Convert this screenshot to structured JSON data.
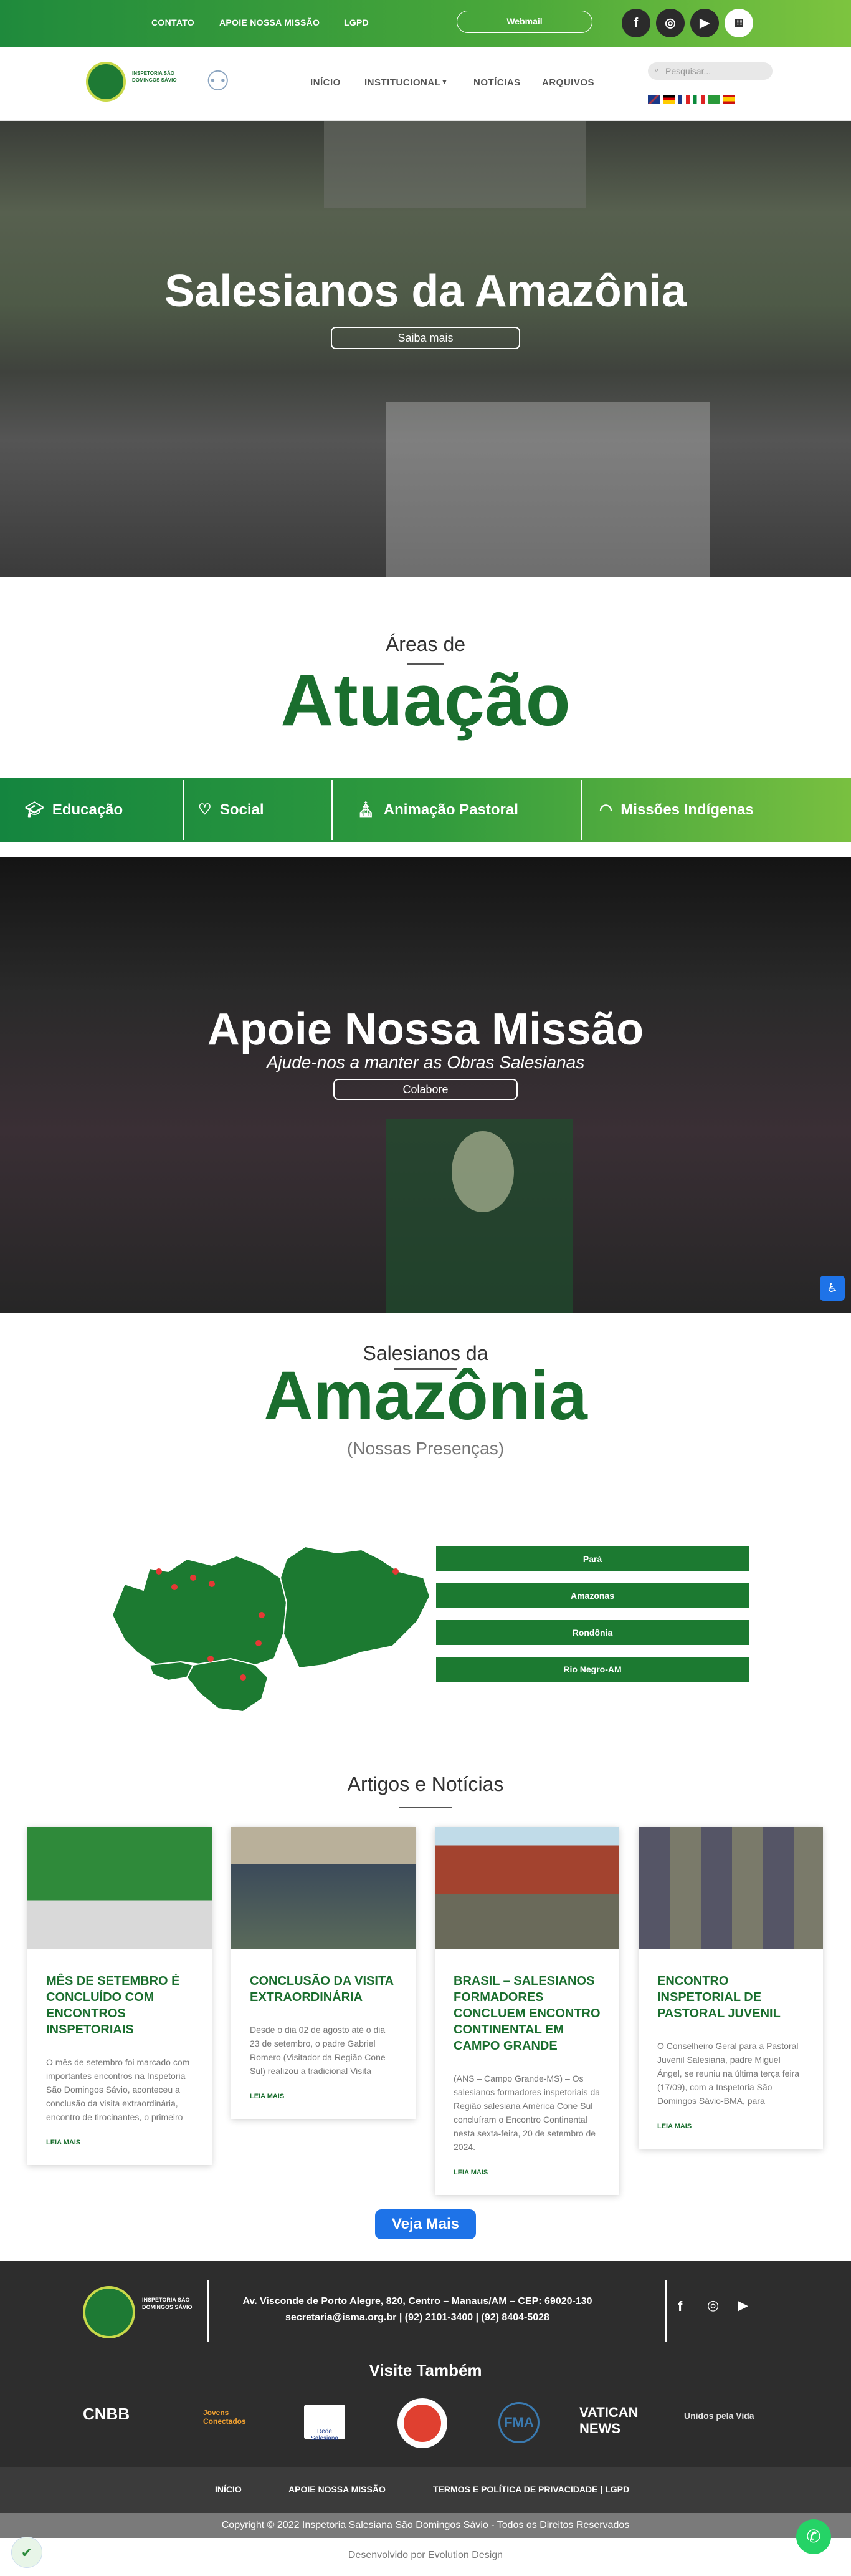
{
  "topbar": {
    "links": [
      "CONTATO",
      "APOIE NOSSA MISSÃO",
      "LGPD"
    ],
    "webmail": "Webmail",
    "social": [
      "facebook-icon",
      "instagram-icon",
      "youtube-icon",
      "qr-icon"
    ]
  },
  "nav": {
    "items": [
      "INÍCIO",
      "INSTITUCIONAL",
      "NOTÍCIAS",
      "ARQUIVOS"
    ],
    "search_placeholder": "Pesquisar...",
    "logo_text": "INSPETORIA SÃO DOMINGOS SÁVIO"
  },
  "hero": {
    "title": "Salesianos da Amazônia",
    "button": "Saiba mais"
  },
  "areas": {
    "small": "Áreas de",
    "big": "Atuação",
    "items": [
      "Educação",
      "Social",
      "Animação Pastoral",
      "Missões Indígenas"
    ]
  },
  "mission": {
    "title": "Apoie Nossa Missão",
    "subtitle": "Ajude-nos a manter as Obras Salesianas",
    "button": "Colabore"
  },
  "amazonia": {
    "small": "Salesianos da",
    "big": "Amazônia",
    "presencas": "(Nossas Presenças)",
    "states": [
      "Pará",
      "Amazonas",
      "Rondônia",
      "Rio Negro-AM"
    ]
  },
  "news": {
    "title": "Artigos e Notícias",
    "more_label": "LEIA MAIS",
    "cards": [
      {
        "title": "MÊS DE SETEMBRO É CONCLUÍDO COM ENCONTROS INSPETORIAIS",
        "excerpt": "O mês de setembro foi marcado com importantes encontros na Inspetoria São Domingos Sávio, aconteceu a conclusão da visita extraordinária, encontro de tirocinantes, o primeiro"
      },
      {
        "title": "CONCLUSÃO DA VISITA EXTRAORDINÁRIA",
        "excerpt": "Desde o dia 02 de agosto até o dia 23 de setembro, o padre Gabriel Romero (Visitador da Região Cone Sul) realizou a tradicional Visita"
      },
      {
        "title": "BRASIL – SALESIANOS FORMADORES CONCLUEM ENCONTRO CONTINENTAL EM CAMPO GRANDE",
        "excerpt": "(ANS – Campo Grande-MS) – Os salesianos formadores inspetoriais da Região salesiana América Cone Sul concluíram o Encontro Continental nesta sexta-feira, 20 de setembro de 2024."
      },
      {
        "title": "ENCONTRO INSPETORIAL DE PASTORAL JUVENIL",
        "excerpt": "O Conselheiro Geral para a Pastoral Juvenil Salesiana, padre Miguel Ángel, se reuniu na última terça feira (17/09), com a Inspetoria São Domingos Sávio-BMA, para"
      }
    ],
    "veja_mais": "Veja Mais"
  },
  "footer": {
    "address": "Av. Visconde de Porto Alegre, 820, Centro – Manaus/AM – CEP: 69020-130",
    "contact": "secretaria@isma.org.br | (92) 2101-3400 | (92) 8404-5028",
    "visite": "Visite Também",
    "partners": [
      "CNBB",
      "Jovens Conectados",
      "Rede Salesiana",
      "FMA",
      "VATICAN NEWS",
      "Unidos pela Vida"
    ],
    "menu": [
      "INÍCIO",
      "APOIE NOSSA MISSÃO",
      "TERMOS E POLÍTICA DE PRIVACIDADE | LGPD"
    ],
    "copyright": "Copyright © 2022 Inspetoria Salesiana São Domingos Sávio - Todos os Direitos Reservados",
    "developer": "Desenvolvido por Evolution Design"
  },
  "colors": {
    "brand_green": "#1a6e2e",
    "accent_blue": "#1e73e8",
    "footer_dark": "#2d2d2d"
  }
}
